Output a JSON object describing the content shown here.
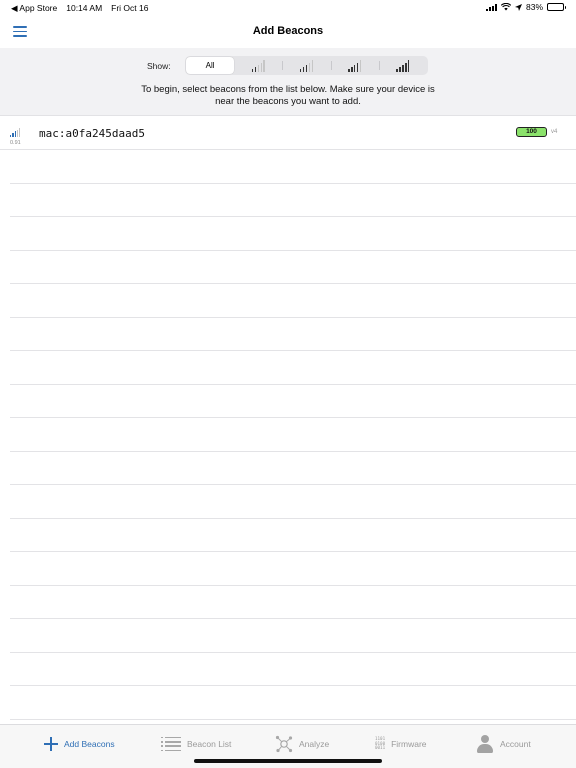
{
  "status_bar": {
    "back_app": "◀ App Store",
    "time": "10:14 AM",
    "date": "Fri Oct 16",
    "battery_percent": "83%",
    "battery_level": 0.83
  },
  "nav": {
    "title": "Add Beacons"
  },
  "filter": {
    "show_label": "Show:",
    "segments": [
      {
        "label": "All",
        "level": 0,
        "selected": true
      },
      {
        "label": "",
        "level": 1,
        "selected": false
      },
      {
        "label": "",
        "level": 2,
        "selected": false
      },
      {
        "label": "",
        "level": 3,
        "selected": false
      },
      {
        "label": "",
        "level": 4,
        "selected": false
      }
    ],
    "instructions": "To begin, select beacons from the list below. Make sure your device is near the beacons you want to add."
  },
  "beacons": [
    {
      "rssi_value": "0.91",
      "signal_level": 3,
      "mac": "mac:a0fa245daad5",
      "battery": "100",
      "version": "v4"
    }
  ],
  "tabs": [
    {
      "label": "Add Beacons",
      "icon": "plus-icon",
      "active": true
    },
    {
      "label": "Beacon List",
      "icon": "list-icon",
      "active": false
    },
    {
      "label": "Analyze",
      "icon": "analyze-icon",
      "active": false
    },
    {
      "label": "Firmware",
      "icon": "binary-icon",
      "firmware_glyph": [
        "1101",
        "0100",
        "0011"
      ],
      "active": false
    },
    {
      "label": "Account",
      "icon": "person-icon",
      "active": false
    }
  ],
  "colors": {
    "accent": "#2f6fb5",
    "battery_badge": "#8be26b",
    "inactive_tab": "#9a9a9a"
  }
}
